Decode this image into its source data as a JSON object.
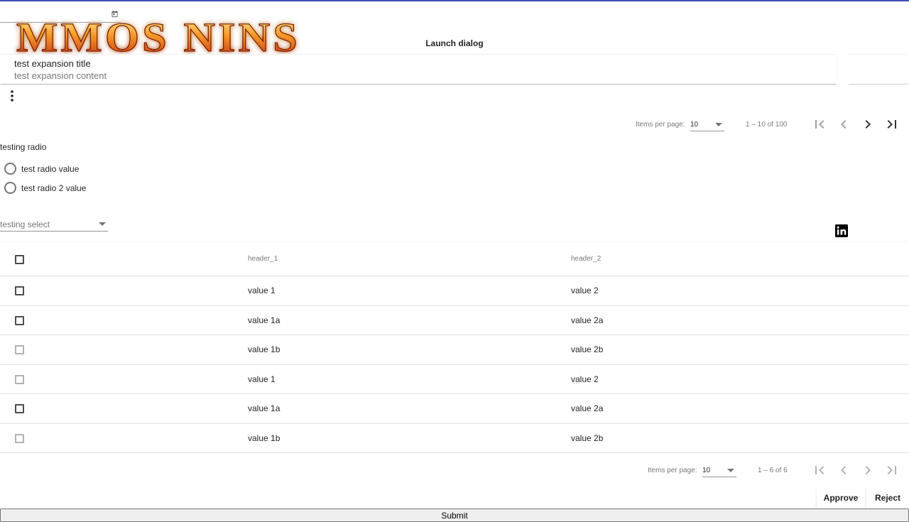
{
  "logo_text": "MMOS NINS",
  "launch_dialog_label": "Launch dialog",
  "expansion": {
    "title": "test expansion title",
    "content": "test expansion content"
  },
  "paginator_top": {
    "items_label": "Items per page:",
    "page_size": "10",
    "range": "1 – 10 of 100"
  },
  "radio": {
    "label": "testing radio",
    "options": [
      "test radio value",
      "test radio 2 value"
    ]
  },
  "select": {
    "placeholder": "testing select"
  },
  "table": {
    "headers": [
      "header_1",
      "header_2"
    ],
    "rows": [
      [
        "value 1",
        "value 2"
      ],
      [
        "value 1a",
        "value 2a"
      ],
      [
        "value 1b",
        "value 2b"
      ],
      [
        "value 1",
        "value 2"
      ],
      [
        "value 1a",
        "value 2a"
      ],
      [
        "value 1b",
        "value 2b"
      ]
    ]
  },
  "paginator_bottom": {
    "items_label": "Items per page:",
    "page_size": "10",
    "range": "1 – 6 of 6"
  },
  "actions": {
    "approve": "Approve",
    "reject": "Reject",
    "submit": "Submit"
  },
  "icons": {
    "calendar": "calendar-icon",
    "menu": "more-vert-icon",
    "first": "first-page-icon",
    "prev": "chevron-left-icon",
    "next": "chevron-right-icon",
    "last": "last-page-icon",
    "linkedin": "linkedin-icon"
  },
  "colors": {
    "accent": "#3f51b5",
    "logo_fire": "#e8661a"
  }
}
